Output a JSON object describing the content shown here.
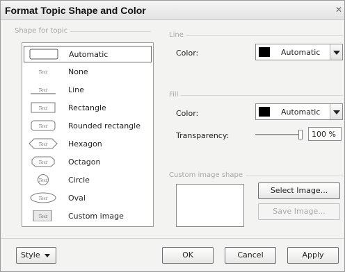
{
  "dialog": {
    "title": "Format Topic Shape and Color"
  },
  "shape_section": {
    "label": "Shape for topic",
    "items": [
      {
        "label": "Automatic",
        "shape": "automatic",
        "selected": true
      },
      {
        "label": "None",
        "shape": "none",
        "sample": "Text"
      },
      {
        "label": "Line",
        "shape": "line",
        "sample": "Text"
      },
      {
        "label": "Rectangle",
        "shape": "rectangle",
        "sample": "Text"
      },
      {
        "label": "Rounded rectangle",
        "shape": "rounded-rectangle",
        "sample": "Text"
      },
      {
        "label": "Hexagon",
        "shape": "hexagon",
        "sample": "Text"
      },
      {
        "label": "Octagon",
        "shape": "octagon",
        "sample": "Text"
      },
      {
        "label": "Circle",
        "shape": "circle",
        "sample": "Text"
      },
      {
        "label": "Oval",
        "shape": "oval",
        "sample": "Text"
      },
      {
        "label": "Custom image",
        "shape": "custom-image",
        "sample": "Text"
      }
    ]
  },
  "line_section": {
    "label": "Line",
    "color_label": "Color:",
    "color_value": "Automatic",
    "swatch_color": "#000000"
  },
  "fill_section": {
    "label": "Fill",
    "color_label": "Color:",
    "color_value": "Automatic",
    "swatch_color": "#000000",
    "transparency_label": "Transparency:",
    "transparency_value": "100 %",
    "transparency_level": 100
  },
  "custom_image_section": {
    "label": "Custom image shape",
    "select_button": "Select Image...",
    "save_button": "Save Image...",
    "save_enabled": false
  },
  "footer": {
    "style_button": "Style",
    "ok_button": "OK",
    "cancel_button": "Cancel",
    "apply_button": "Apply"
  }
}
